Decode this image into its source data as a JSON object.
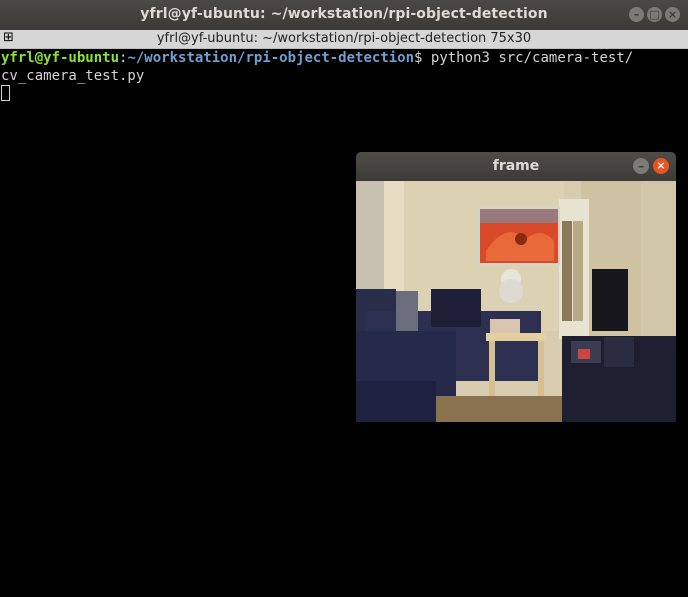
{
  "window": {
    "title": "yfrl@yf-ubuntu: ~/workstation/rpi-object-detection",
    "controls": [
      "minimize-icon",
      "maximize-icon",
      "close-icon"
    ]
  },
  "terminal_strip": {
    "title": "yfrl@yf-ubuntu: ~/workstation/rpi-object-detection 75x30"
  },
  "terminal": {
    "prompt_user": "yfrl@yf-ubuntu",
    "prompt_sep": ":",
    "prompt_path": "~/workstation/rpi-object-detection",
    "prompt_symbol": "$ ",
    "command_line1": "python3 src/camera-test/",
    "command_line2": "cv_camera_test.py"
  },
  "frame_window": {
    "title": "frame",
    "image_desc": "camera-feed"
  },
  "colors": {
    "prompt_user": "#8ae234",
    "prompt_path": "#729fcf",
    "close_button": "#e95420",
    "terminal_bg": "#000000"
  }
}
